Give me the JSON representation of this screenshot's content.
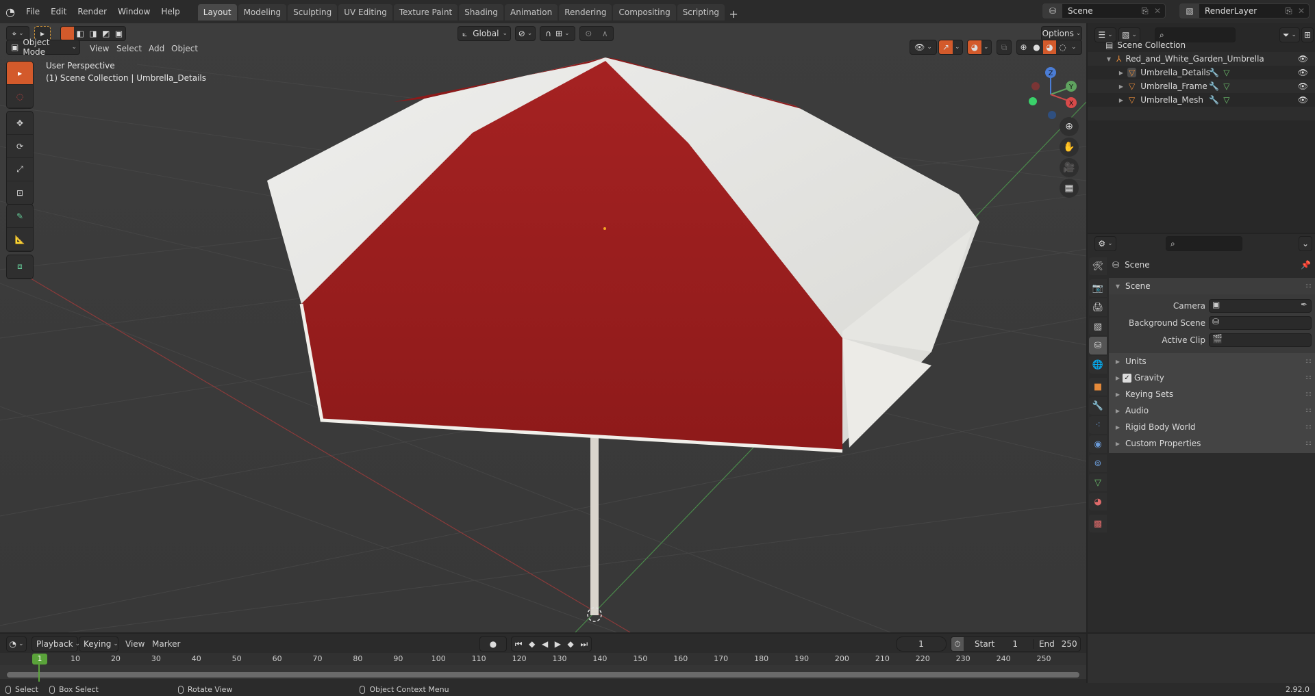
{
  "app": {
    "version": "2.92.0"
  },
  "topbar": {
    "menus": [
      "File",
      "Edit",
      "Render",
      "Window",
      "Help"
    ],
    "workspaces": [
      "Layout",
      "Modeling",
      "Sculpting",
      "UV Editing",
      "Texture Paint",
      "Shading",
      "Animation",
      "Rendering",
      "Compositing",
      "Scripting"
    ],
    "active_workspace": "Layout",
    "add_workspace": "+",
    "scene_name": "Scene",
    "view_layer": "RenderLayer"
  },
  "viewport": {
    "mode": "Object Mode",
    "menus": [
      "View",
      "Select",
      "Add",
      "Object"
    ],
    "transform_orientation": "Global",
    "options_label": "Options",
    "overlay_title": "User Perspective",
    "overlay_subtitle": "(1) Scene Collection | Umbrella_Details",
    "gizmo_axes": {
      "x": "X",
      "y": "Y",
      "z": "Z"
    },
    "colors": {
      "accent": "#d35a2b",
      "umbrella_red": "#9b1e1e",
      "umbrella_white": "#e8e8e4",
      "x_axis": "#c94a4a",
      "y_axis": "#5fa35f"
    },
    "tools": [
      "select-box",
      "cursor",
      "move",
      "rotate",
      "scale",
      "transform",
      "annotate",
      "measure",
      "add-cube"
    ],
    "nav_buttons": [
      "zoom",
      "pan",
      "camera",
      "ortho-grid"
    ]
  },
  "outliner": {
    "root": "Scene Collection",
    "collection": "Red_and_White_Garden_Umbrella",
    "objects": [
      {
        "name": "Umbrella_Details",
        "selected": true
      },
      {
        "name": "Umbrella_Frame",
        "selected": false
      },
      {
        "name": "Umbrella_Mesh",
        "selected": false
      }
    ]
  },
  "properties": {
    "context": "Scene",
    "panel_title": "Scene",
    "fields": [
      {
        "label": "Camera",
        "value": ""
      },
      {
        "label": "Background Scene",
        "value": ""
      },
      {
        "label": "Active Clip",
        "value": ""
      }
    ],
    "subpanels": [
      {
        "label": "Units",
        "checkbox": false
      },
      {
        "label": "Gravity",
        "checkbox": true,
        "checked": true
      },
      {
        "label": "Keying Sets",
        "checkbox": false
      },
      {
        "label": "Audio",
        "checkbox": false
      },
      {
        "label": "Rigid Body World",
        "checkbox": false
      },
      {
        "label": "Custom Properties",
        "checkbox": false
      }
    ]
  },
  "timeline": {
    "menus": {
      "playback": "Playback",
      "keying": "Keying",
      "view": "View",
      "marker": "Marker"
    },
    "current_frame": "1",
    "start_label": "Start",
    "start": "1",
    "end_label": "End",
    "end": "250",
    "ticks": [
      "10",
      "20",
      "30",
      "40",
      "50",
      "60",
      "70",
      "80",
      "90",
      "100",
      "110",
      "120",
      "130",
      "140",
      "150",
      "160",
      "170",
      "180",
      "190",
      "200",
      "210",
      "220",
      "230",
      "240",
      "250"
    ],
    "playhead": "1"
  },
  "statusbar": {
    "select": "Select",
    "box_select": "Box Select",
    "rotate_view": "Rotate View",
    "context_menu": "Object Context Menu",
    "version": "2.92.0"
  }
}
